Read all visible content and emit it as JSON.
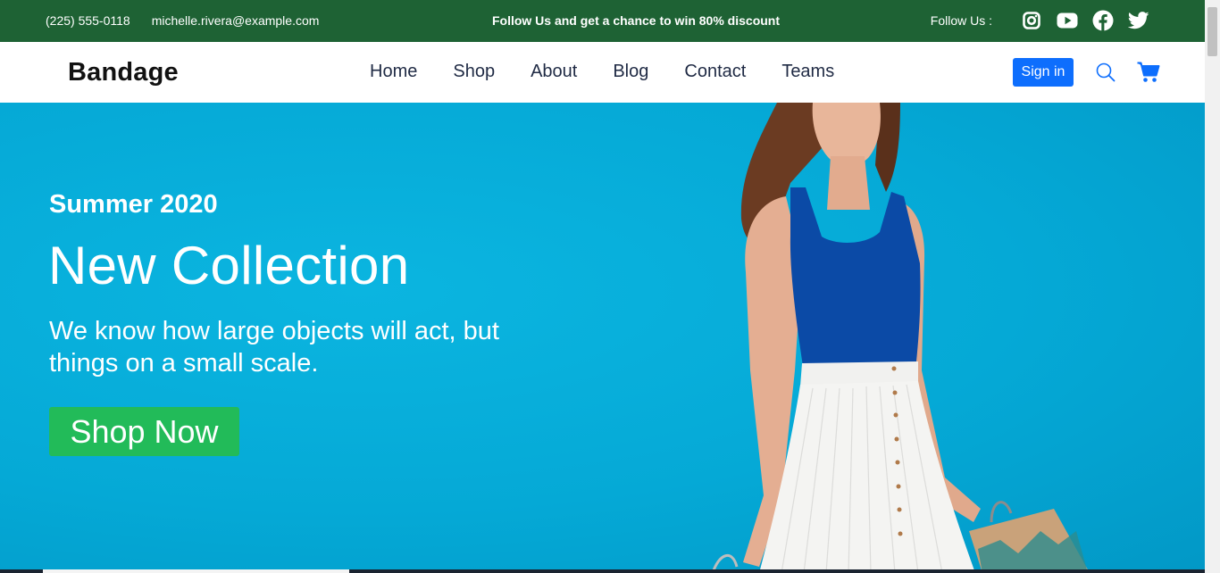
{
  "topbar": {
    "phone": "(225) 555-0118",
    "email": "michelle.rivera@example.com",
    "promo": "Follow Us and get a chance to win 80% discount",
    "follow_label": "Follow Us :",
    "social_icons": [
      "instagram-icon",
      "youtube-icon",
      "facebook-icon",
      "twitter-icon"
    ],
    "background": "#1e6234"
  },
  "navbar": {
    "brand": "Bandage",
    "menu": [
      "Home",
      "Shop",
      "About",
      "Blog",
      "Contact",
      "Teams"
    ],
    "signin_label": "Sign in",
    "icons": [
      "search-icon",
      "cart-icon"
    ],
    "accent": "#0d6efd"
  },
  "hero": {
    "eyebrow": "Summer 2020",
    "headline": "New Collection",
    "tagline": "We know how large objects will act, but things on a small scale.",
    "cta_label": "Shop Now",
    "background": "#05a9d6",
    "cta_color": "#22bb59"
  }
}
